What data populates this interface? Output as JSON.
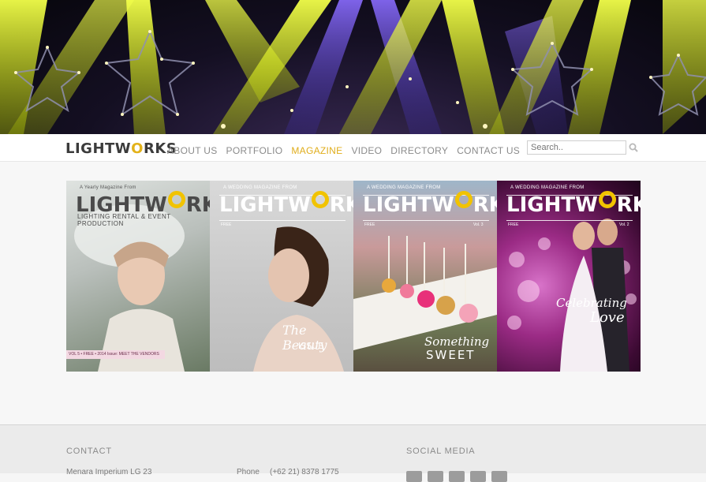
{
  "brand": {
    "logo_prefix": "LIGHTW",
    "logo_o": "O",
    "logo_suffix": "RKS"
  },
  "nav": {
    "items": [
      {
        "label": "ABOUT US"
      },
      {
        "label": "PORTFOLIO"
      },
      {
        "label": "MAGAZINE",
        "active": true
      },
      {
        "label": "VIDEO"
      },
      {
        "label": "DIRECTORY"
      },
      {
        "label": "CONTACT US"
      }
    ]
  },
  "search": {
    "placeholder": "Search.."
  },
  "covers": [
    {
      "tag": "A Yearly Magazine From",
      "brand_pre": "LIGHTW",
      "brand_post": "RKS",
      "subtitle": "LIGHTING RENTAL & EVENT PRODUCTION",
      "strip": "VOL 5 • FREE • 2014 Issue: MEET THE VENDORS"
    },
    {
      "tag": "A WEDDING MAGAZINE FROM",
      "brand_pre": "LIGHTW",
      "brand_post": "RKS",
      "subtitle": "FREE",
      "headline_1": "The Beauty",
      "headline_2": "ISSUE"
    },
    {
      "tag": "A WEDDING MAGAZINE FROM",
      "brand_pre": "LIGHTW",
      "brand_post": "RKS",
      "subtitle": "FREE",
      "issue": "Vol. 3",
      "headline_1": "Something",
      "headline_2": "SWEET"
    },
    {
      "tag": "A WEDDING MAGAZINE FROM",
      "brand_pre": "LIGHTW",
      "brand_post": "RKS",
      "subtitle": "FREE",
      "issue": "Vol. 2",
      "headline_1": "Celebrating",
      "headline_2": "Love"
    }
  ],
  "footer": {
    "contact_title": "CONTACT",
    "social_title": "SOCIAL MEDIA",
    "address": "Menara Imperium LG 23",
    "phone_label": "Phone",
    "phone_value": "(+62 21) 8378 1775"
  },
  "colors": {
    "accent": "#e0ad1b",
    "text": "#8b8b8b",
    "logo": "#3b3b3b"
  }
}
